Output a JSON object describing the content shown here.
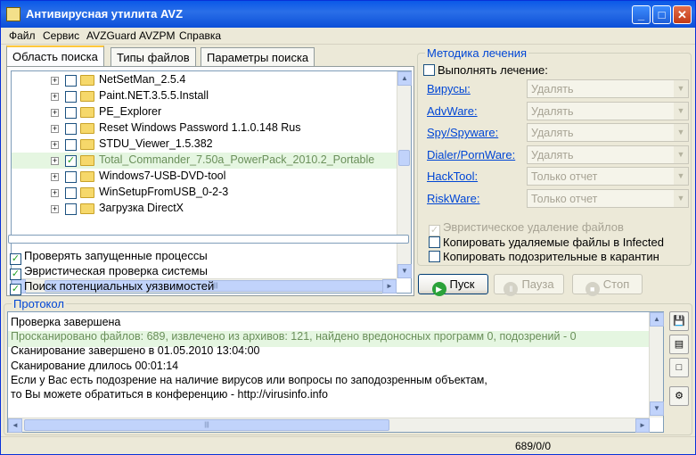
{
  "window": {
    "title": "Антивирусная утилита AVZ",
    "minimize": "_",
    "maximize": "□",
    "close": "✕"
  },
  "menu": [
    "Файл",
    "Сервис",
    "AVZGuard",
    "AVZPM",
    "Справка"
  ],
  "tabs": [
    "Область поиска",
    "Типы файлов",
    "Параметры поиска"
  ],
  "tree": {
    "items": [
      {
        "label": "NetSetMan_2.5.4",
        "checked": false,
        "highlighted": false
      },
      {
        "label": "Paint.NET.3.5.5.Install",
        "checked": false,
        "highlighted": false
      },
      {
        "label": "PE_Explorer",
        "checked": false,
        "highlighted": false
      },
      {
        "label": "Reset Windows Password 1.1.0.148 Rus",
        "checked": false,
        "highlighted": false
      },
      {
        "label": "STDU_Viewer_1.5.382",
        "checked": false,
        "highlighted": false
      },
      {
        "label": "Total_Commander_7.50a_PowerPack_2010.2_Portable",
        "checked": true,
        "highlighted": true
      },
      {
        "label": "Windows7-USB-DVD-tool",
        "checked": false,
        "highlighted": false
      },
      {
        "label": "WinSetupFromUSB_0-2-3",
        "checked": false,
        "highlighted": false
      },
      {
        "label": "Загрузка DirectX",
        "checked": false,
        "highlighted": false
      }
    ],
    "expander": "+"
  },
  "scan_options": [
    {
      "label": "Проверять запущенные процессы",
      "checked": true
    },
    {
      "label": "Эвристическая проверка системы",
      "checked": true
    },
    {
      "label": "Поиск потенциальных уязвимостей",
      "checked": true
    }
  ],
  "treatment": {
    "legend": "Методика лечения",
    "perform": {
      "label": "Выполнять лечение:",
      "checked": false
    },
    "rows": [
      {
        "link": "Вирусы:",
        "value": "Удалять"
      },
      {
        "link": "AdvWare:",
        "value": "Удалять"
      },
      {
        "link": "Spy/Spyware:",
        "value": "Удалять"
      },
      {
        "link": "Dialer/PornWare:",
        "value": "Удалять"
      },
      {
        "link": "HackTool:",
        "value": "Только отчет"
      },
      {
        "link": "RiskWare:",
        "value": "Только отчет"
      }
    ],
    "options": [
      {
        "label": "Эвристическое удаление файлов",
        "checked": true,
        "disabled": true
      },
      {
        "label": "Копировать удаляемые файлы в  Infected",
        "checked": false,
        "disabled": false
      },
      {
        "label": "Копировать подозрительные в  карантин",
        "checked": false,
        "disabled": false
      }
    ]
  },
  "buttons": {
    "start": "Пуск",
    "pause": "Пауза",
    "stop": "Стоп"
  },
  "protocol": {
    "legend": "Протокол",
    "lines": [
      "Проверка завершена",
      "Просканировано файлов: 689, извлечено из архивов: 121, найдено вредоносных программ 0, подозрений - 0",
      "Сканирование завершено в 01.05.2010 13:04:00",
      "Сканирование длилось 00:01:14",
      "Если у Вас есть подозрение на наличие вирусов или вопросы по заподозренным объектам,",
      "то Вы можете обратиться в конференцию - http://virusinfo.info"
    ],
    "highlight_line": 1
  },
  "status": {
    "counts": "689/0/0"
  },
  "icons": {
    "scroll_up": "▲",
    "scroll_down": "▼",
    "scroll_left": "◄",
    "scroll_right": "►",
    "grip": "|||",
    "combo_arrow": "▼",
    "check": "✓"
  },
  "colors": {
    "title_bar": "#0a58e8",
    "link": "#0046d5",
    "highlight": "#b4e6aa"
  }
}
